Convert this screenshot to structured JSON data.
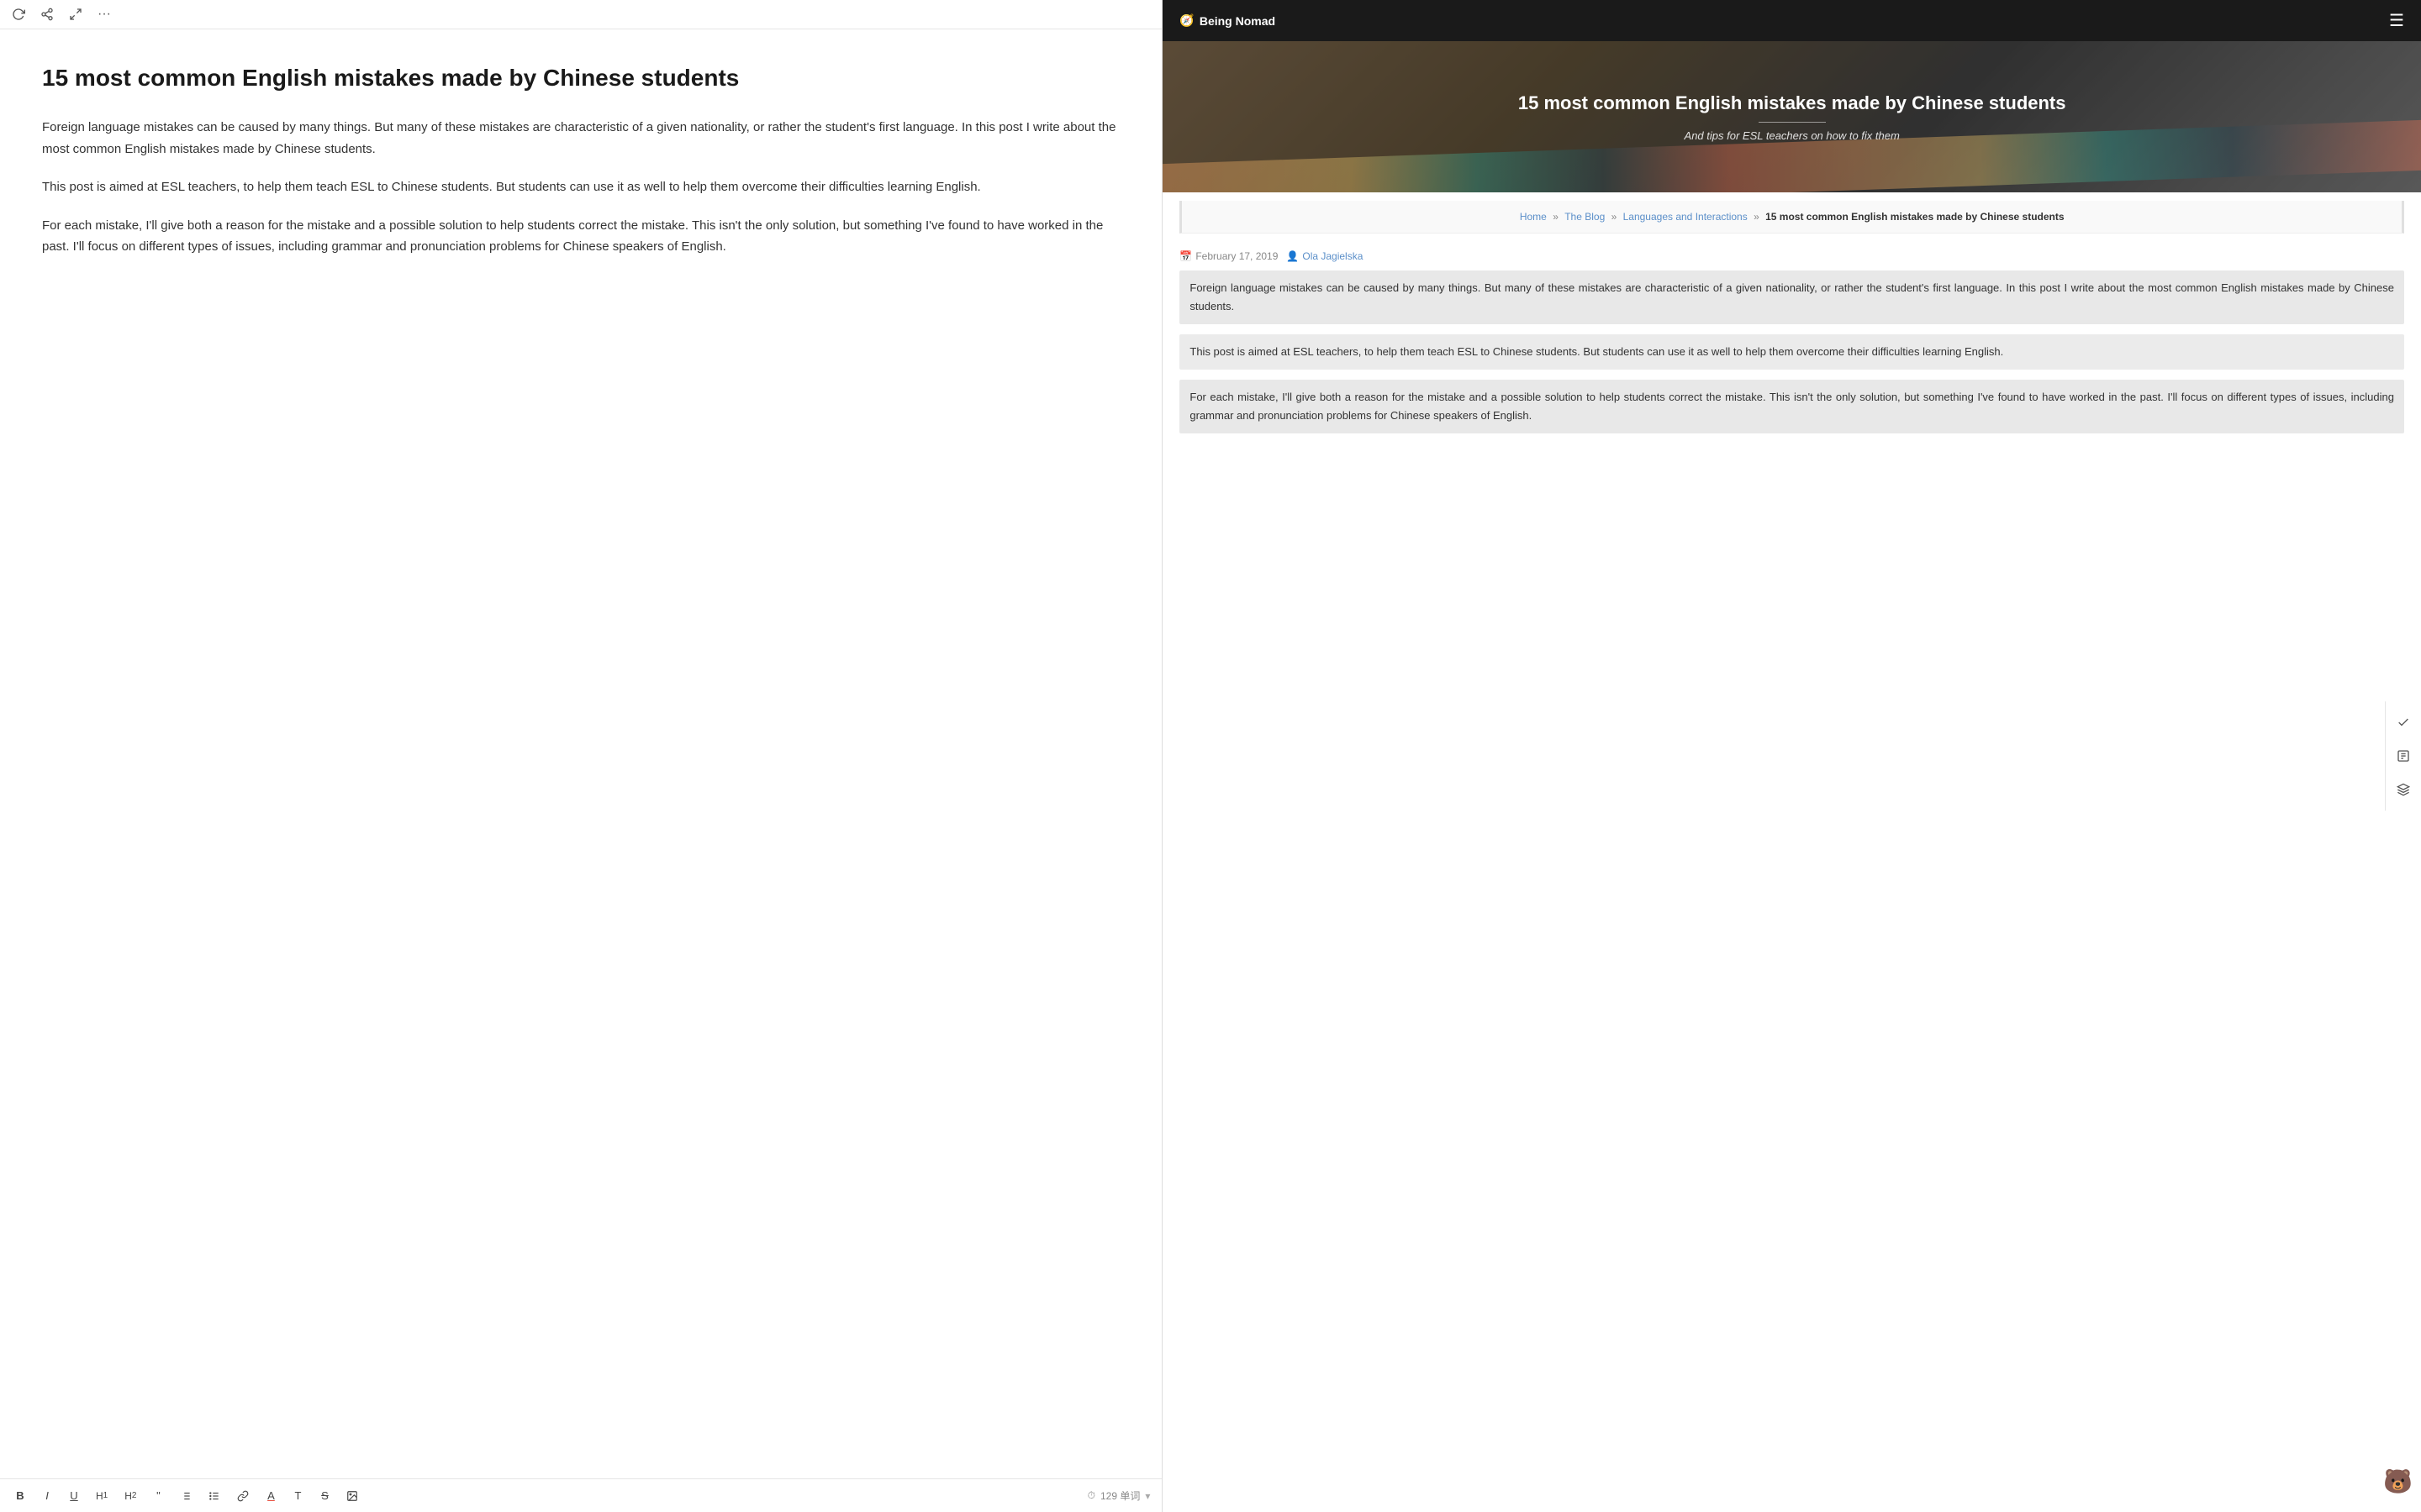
{
  "toolbar_top": {
    "icons": [
      "refresh",
      "share",
      "expand",
      "more"
    ]
  },
  "editor": {
    "title": "15 most common English mistakes made by Chinese students",
    "paragraphs": [
      "Foreign language mistakes can be caused by many things. But many of these mistakes are characteristic of a given nationality, or rather the student's first language. In this post I write about the most common English mistakes made by Chinese students.",
      "This post is aimed at ESL teachers, to help them teach ESL to Chinese students. But students can use it as well to help them overcome their difficulties learning English.",
      "For each mistake, I'll give both a reason for the mistake and a possible solution to help students correct the mistake. This isn't the only solution, but something I've found to have worked in the past. I'll focus on different types of issues, including grammar and pronunciation problems for Chinese speakers of English."
    ]
  },
  "toolbar_bottom": {
    "formats": [
      "B",
      "I",
      "U",
      "H1",
      "H2",
      "\"",
      "OL",
      "UL",
      "link",
      "A",
      "T",
      "S",
      "img"
    ],
    "word_count_label": "129 单词",
    "clock_icon": "⏱"
  },
  "website": {
    "nav": {
      "logo_text": "Being Nomad",
      "logo_icon": "🧭"
    },
    "hero": {
      "title": "15 most common English mistakes made by Chinese students",
      "subtitle": "And tips for ESL teachers on how to fix them"
    },
    "breadcrumb": {
      "home": "Home",
      "blog": "The Blog",
      "category": "Languages and Interactions",
      "current": "15 most common English mistakes made by Chinese students"
    },
    "meta": {
      "date": "February 17, 2019",
      "author": "Ola Jagielska"
    },
    "paragraphs": [
      "Foreign language mistakes can be caused by many things. But many of these mistakes are characteristic of a given nationality, or rather the student's first language. In this post I write about the most common English mistakes made by Chinese students.",
      "This post is aimed at ESL teachers, to help them teach ESL to Chinese students. But students can use it as well to help them overcome their difficulties learning English.",
      "For each mistake, I'll give both a reason for the mistake and a possible solution to help students correct the mistake. This isn't the only solution, but something I've found to have worked in the past. I'll focus on different types of issues, including grammar and pronunciation problems for Chinese speakers of English."
    ]
  },
  "side_toolbar": {
    "icons": [
      "check",
      "formula",
      "layers"
    ]
  }
}
